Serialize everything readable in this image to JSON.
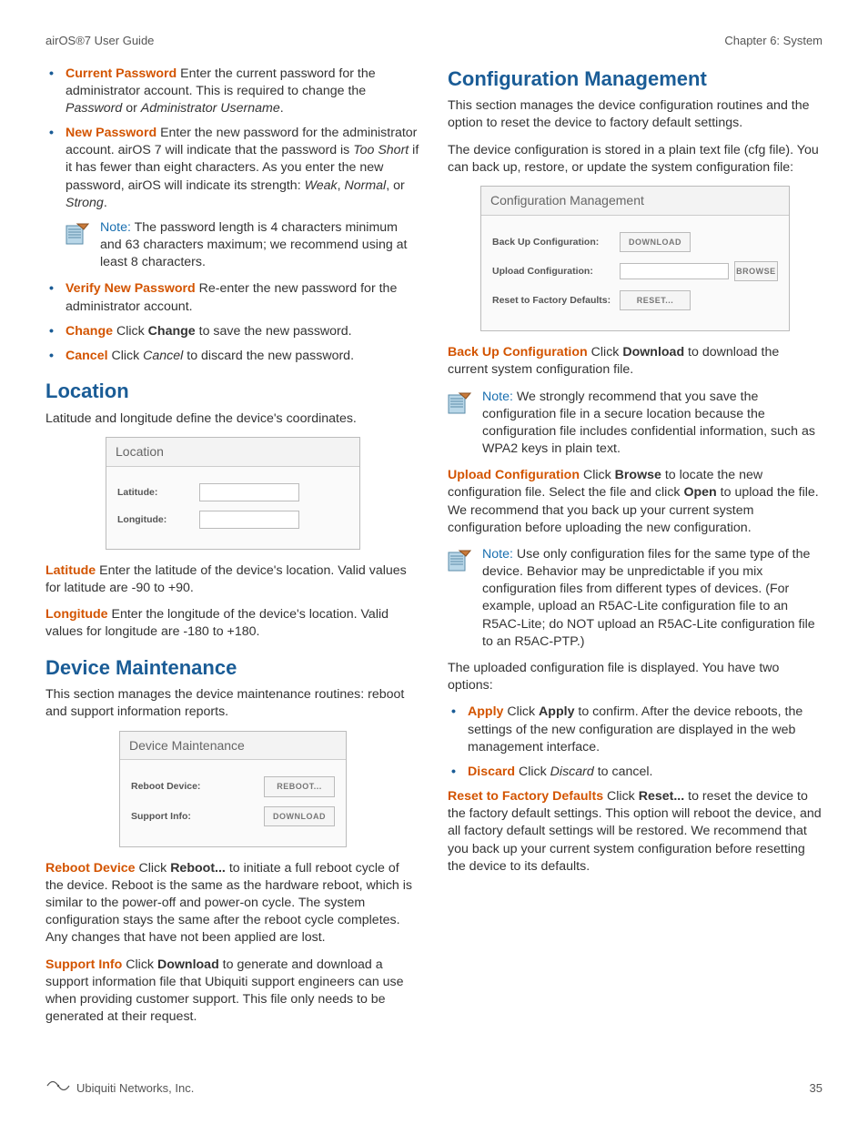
{
  "header": {
    "left": "airOS®7 User Guide",
    "right": "Chapter 6: System"
  },
  "left": {
    "bullets1": [
      {
        "term": "Current Password",
        "body_a": "  Enter the current password for the administrator account. This is required to change the ",
        "ital1": "Password",
        "mid": " or ",
        "ital2": "Administrator Username",
        "end": "."
      },
      {
        "term": "New Password",
        "body_a": "  Enter the new password for the administrator account. airOS 7 will indicate that the password is ",
        "ital1": "Too Short",
        "mid": " if it has fewer than eight characters. As you enter the new password, airOS will indicate its strength: ",
        "ital2": "Weak",
        "mid2": ", ",
        "ital3": "Normal",
        "mid3": ", or ",
        "ital4": "Strong",
        "end": "."
      }
    ],
    "note1": {
      "label": "Note:",
      "body": " The password length is 4 characters minimum and 63 characters maximum; we recommend using at least 8 characters."
    },
    "bullets2": [
      {
        "term": "Verify New Password",
        "body_a": "  Re-enter the new password for the administrator account."
      },
      {
        "term": "Change",
        "body_a": "  Click ",
        "bold": "Change",
        "body_b": " to save the new password."
      },
      {
        "term": "Cancel",
        "body_a": "  Click ",
        "ital1": "Cancel",
        "body_b": " to discard the new password."
      }
    ],
    "location": {
      "heading": "Location",
      "intro": "Latitude and longitude define the device's coordinates.",
      "panel": {
        "title": "Location",
        "row1": "Latitude:",
        "row2": "Longitude:"
      },
      "lat": {
        "term": "Latitude",
        "body": "  Enter the latitude of the device's location. Valid values for latitude are -90 to +90."
      },
      "lon": {
        "term": "Longitude",
        "body": "  Enter the longitude of the device's location. Valid values for longitude are -180 to +180."
      }
    },
    "maint": {
      "heading": "Device Maintenance",
      "intro": "This section manages the device maintenance routines: reboot and support information reports.",
      "panel": {
        "title": "Device Maintenance",
        "row1": "Reboot Device:",
        "btn1": "REBOOT...",
        "row2": "Support Info:",
        "btn2": "DOWNLOAD"
      },
      "reboot": {
        "term": "Reboot Device",
        "pre": "  Click ",
        "bold": "Reboot...",
        "post": " to initiate a full reboot cycle of the device. Reboot is the same as the hardware reboot, which is similar to the power-off and power-on cycle. The system configuration stays the same after the reboot cycle completes. Any changes that have not been applied are lost."
      },
      "support": {
        "term": "Support Info",
        "pre": "  Click ",
        "bold": "Download",
        "post": " to generate and download a support information file that Ubiquiti support engineers can use when providing customer support. This file only needs to be generated at their request."
      }
    }
  },
  "right": {
    "heading": "Configuration Management",
    "intro1": "This section manages the device configuration routines and the option to reset the device to factory default settings.",
    "intro2": "The device configuration is stored in a plain text file (cfg file). You can back up, restore, or update the system configuration file:",
    "panel": {
      "title": "Configuration Management",
      "row1": "Back Up Configuration:",
      "btn1": "DOWNLOAD",
      "row2": "Upload Configuration:",
      "btn2": "BROWSE",
      "row3": "Reset to Factory Defaults:",
      "btn3": "RESET..."
    },
    "backup": {
      "term": "Back Up Configuration",
      "pre": "  Click ",
      "bold": "Download",
      "post": " to download the current system configuration file."
    },
    "note2": {
      "label": "Note:",
      "body": " We strongly recommend that you save the configuration file in a secure location because the configuration file includes confidential information, such as WPA2 keys in plain text."
    },
    "upload": {
      "term": "Upload Configuration",
      "pre": "  Click ",
      "bold1": "Browse",
      "mid": " to locate the new configuration file. Select the file and click ",
      "bold2": "Open",
      "post": " to upload the file. We recommend that you back up your current system configuration before uploading the new configuration."
    },
    "note3": {
      "label": "Note:",
      "body": " Use only configuration files for the same type of the device. Behavior may be unpredictable if you mix configuration files from different types of devices. (For example, upload an R5AC-Lite configuration file to an R5AC-Lite; do NOT upload an R5AC-Lite configuration file to an R5AC-PTP.)"
    },
    "uploaded": "The uploaded configuration file is displayed. You have two options:",
    "bullets": [
      {
        "term": "Apply",
        "pre": "  Click ",
        "bold": "Apply",
        "post": " to confirm. After the device reboots, the settings of the new configuration are displayed in the web management interface."
      },
      {
        "term": "Discard",
        "pre": "  Click ",
        "ital": "Discard",
        "post": " to cancel."
      }
    ],
    "reset": {
      "term": "Reset to Factory Defaults",
      "pre": "  Click ",
      "bold": "Reset...",
      "post": " to reset the device to the factory default settings. This option will reboot the device, and all factory default settings will be restored. We recommend that you back up your current system configuration before resetting the device to its defaults."
    }
  },
  "footer": {
    "company": "Ubiquiti Networks, Inc.",
    "page": "35"
  }
}
